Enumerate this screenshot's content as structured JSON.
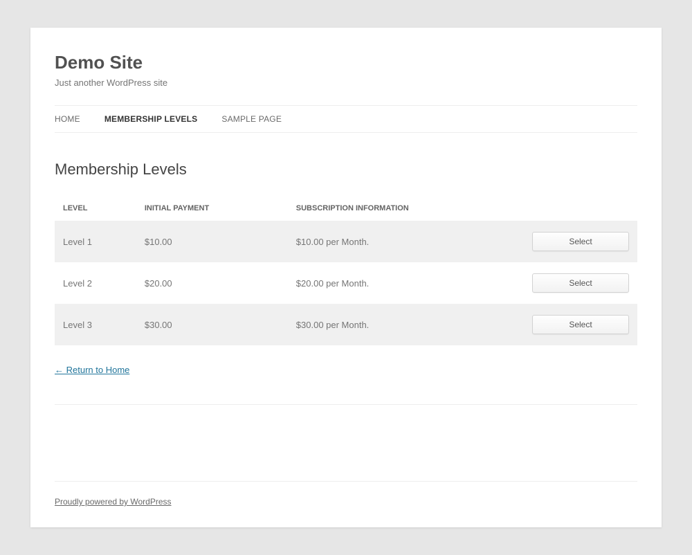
{
  "header": {
    "title": "Demo Site",
    "tagline": "Just another WordPress site"
  },
  "nav": {
    "items": [
      {
        "label": "HOME",
        "current": false
      },
      {
        "label": "MEMBERSHIP LEVELS",
        "current": true
      },
      {
        "label": "SAMPLE PAGE",
        "current": false
      }
    ]
  },
  "page": {
    "title": "Membership Levels"
  },
  "table": {
    "headers": {
      "level": "Level",
      "initial": "Initial Payment",
      "subscription": "Subscription Information"
    },
    "rows": [
      {
        "level": "Level 1",
        "initial": "$10.00",
        "subscription": "$10.00 per Month.",
        "action": "Select"
      },
      {
        "level": "Level 2",
        "initial": "$20.00",
        "subscription": "$20.00 per Month.",
        "action": "Select"
      },
      {
        "level": "Level 3",
        "initial": "$30.00",
        "subscription": "$30.00 per Month.",
        "action": "Select"
      }
    ]
  },
  "links": {
    "return": "← Return to Home"
  },
  "footer": {
    "credit": "Proudly powered by WordPress"
  }
}
